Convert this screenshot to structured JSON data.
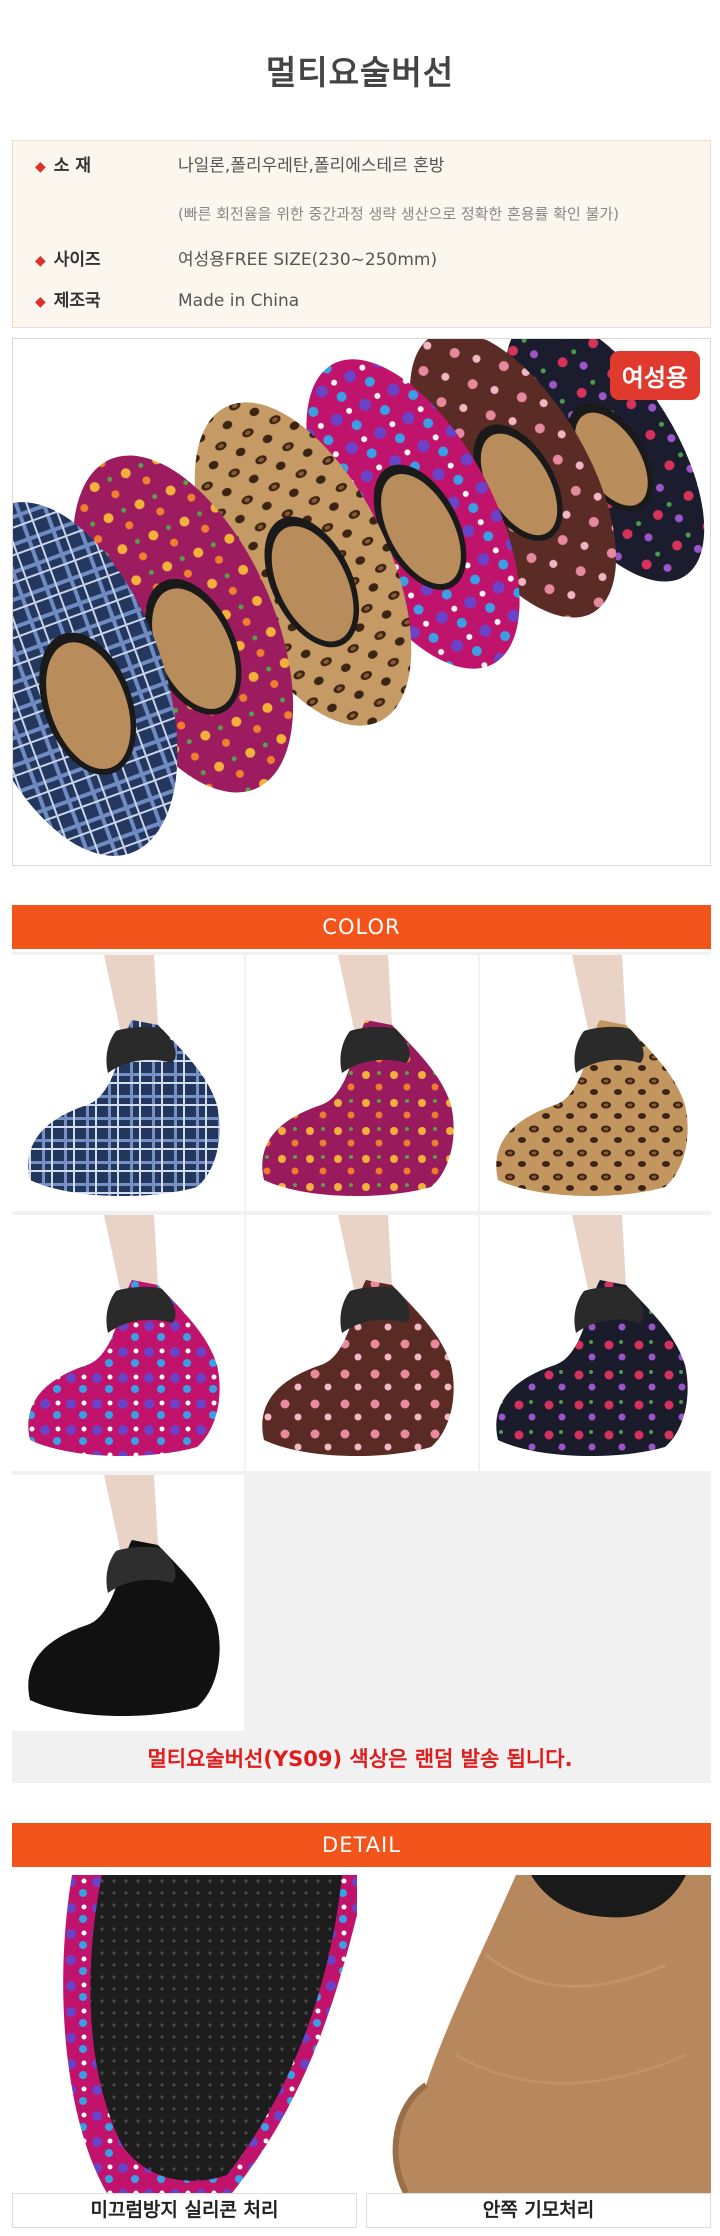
{
  "title": "멀티요술버선",
  "spec": {
    "material_label": "소   재",
    "material_value": "나일론,폴리우레탄,폴리에스테르 혼방",
    "material_note": "(빠른 회전율을 위한 중간과정 생략 생산으로 정확한 혼용률 확인 불가)",
    "size_label": "사이즈",
    "size_value": "여성용FREE SIZE(230~250mm)",
    "origin_label": "제조국",
    "origin_value": "Made in China"
  },
  "hero": {
    "badge": "여성용"
  },
  "color_section": {
    "header": "COLOR",
    "swatches": [
      {
        "pattern": "blue-plaid"
      },
      {
        "pattern": "magenta-floral"
      },
      {
        "pattern": "leopard"
      },
      {
        "pattern": "pink-letters"
      },
      {
        "pattern": "brown-floral"
      },
      {
        "pattern": "navy-rose"
      },
      {
        "pattern": "black"
      }
    ],
    "notice": "멀티요술버선(YS09) 색상은 랜덤 발송 됩니다."
  },
  "detail_section": {
    "header": "DETAIL",
    "items": [
      {
        "caption": "미끄럼방지 실리콘 처리"
      },
      {
        "caption": "안쪽 기모처리"
      }
    ]
  },
  "colors": {
    "accent_orange": "#f2541c",
    "badge_red": "#e03a2f",
    "notice_red": "#e01d1d",
    "spec_bg": "#fbf6ee"
  }
}
